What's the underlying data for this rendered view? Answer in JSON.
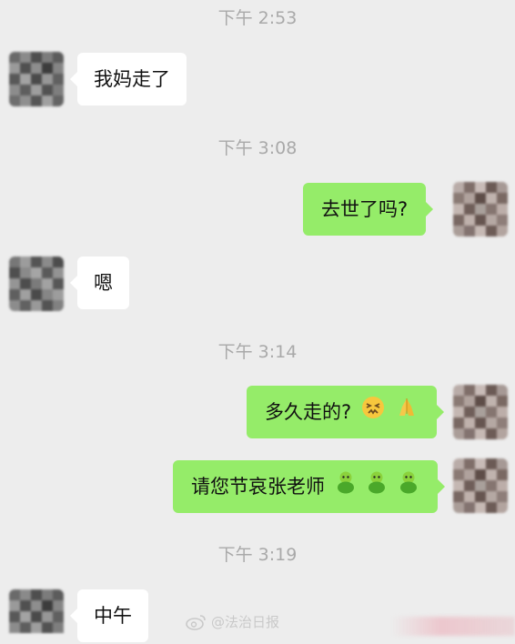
{
  "timestamps": {
    "t1": "下午 2:53",
    "t2": "下午 3:08",
    "t3": "下午 3:14",
    "t4": "下午 3:19"
  },
  "messages": {
    "m1": "我妈走了",
    "m2": "去世了吗?",
    "m3": "嗯",
    "m4": "多久走的?",
    "m5": "请您节哀张老师",
    "m6": "中午"
  },
  "emojis": {
    "m4": [
      "confounded-face",
      "folded-hands"
    ],
    "m5": [
      "green-figure",
      "green-figure",
      "green-figure"
    ]
  },
  "watermark": {
    "text": "@法治日报"
  },
  "colors": {
    "background": "#ededed",
    "incoming_bubble": "#ffffff",
    "outgoing_bubble": "#95ec69",
    "timestamp": "#a9a9a9"
  }
}
